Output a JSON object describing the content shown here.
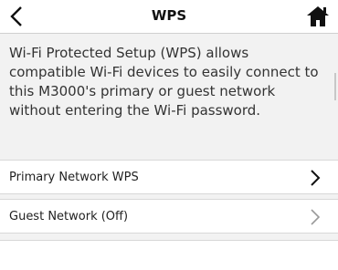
{
  "header": {
    "title": "WPS",
    "back_icon": "chevron-left-icon",
    "home_icon": "home-icon"
  },
  "description": "Wi-Fi Protected Setup (WPS) allows compatible Wi-Fi devices to easily connect to this M3000's primary or guest network without entering the Wi-Fi password.",
  "menu": {
    "items": [
      {
        "label": "Primary Network WPS",
        "enabled": true,
        "chevron_color": "#111111"
      },
      {
        "label": "Guest Network (Off)",
        "enabled": false,
        "chevron_color": "#9a9a9a"
      }
    ]
  }
}
